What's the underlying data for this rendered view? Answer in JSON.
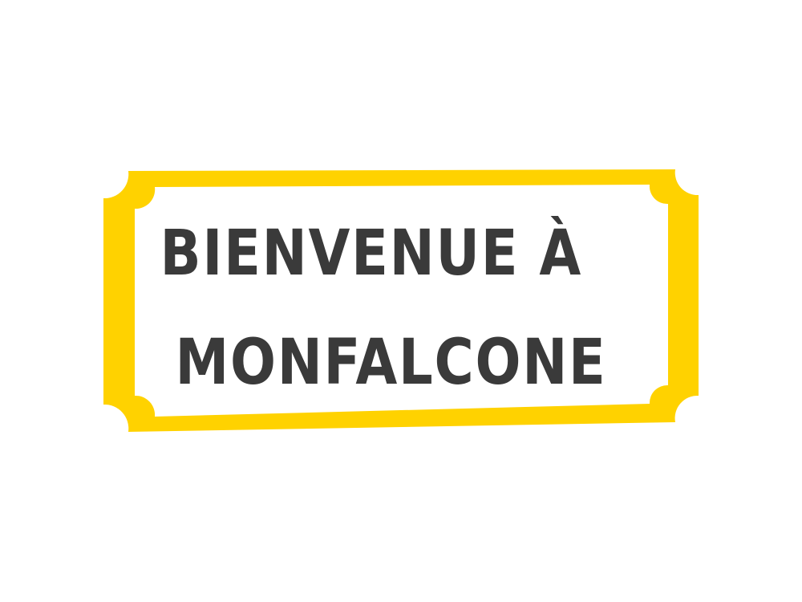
{
  "sign": {
    "line1": "BIENVENUE À",
    "line2": "MONFALCONE",
    "frame_color": "#ffd200",
    "text_color": "#3a3a3a",
    "panel_color": "#ffffff"
  }
}
